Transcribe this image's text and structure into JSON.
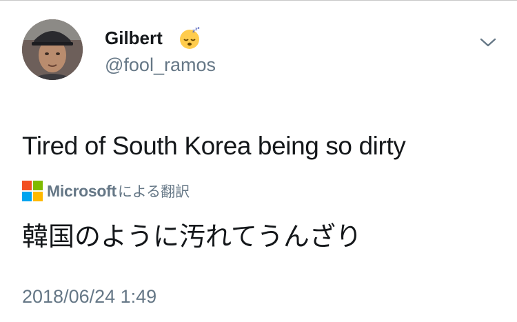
{
  "user": {
    "display_name": "Gilbert",
    "handle": "@fool_ramos",
    "status_emoji": "sleeping-face-emoji"
  },
  "tweet": {
    "text": "Tired of South Korea being so dirty",
    "timestamp": "2018/06/24 1:49"
  },
  "translation": {
    "provider_name": "Microsoft",
    "provider_suffix": "による翻訳",
    "text": "韓国のように汚れてうんざり"
  },
  "icons": {
    "menu": "chevron-down-icon",
    "provider_logo": "microsoft-logo"
  },
  "colors": {
    "primary_text": "#14171a",
    "secondary_text": "#657786",
    "ms_red": "#f25022",
    "ms_green": "#7fba00",
    "ms_blue": "#00a4ef",
    "ms_yellow": "#ffb900"
  }
}
